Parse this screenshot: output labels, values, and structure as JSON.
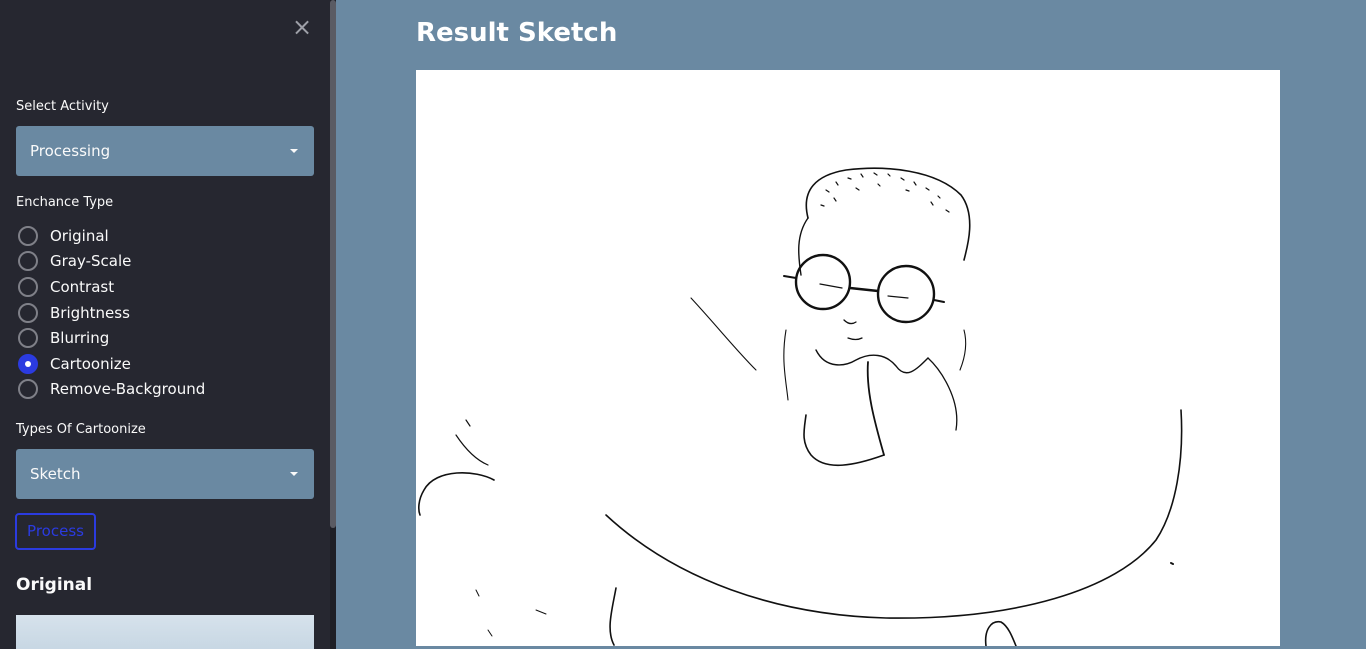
{
  "sidebar": {
    "close_label": "×",
    "select_activity": {
      "label": "Select Activity",
      "value": "Processing"
    },
    "enhance_type": {
      "label": "Enchance Type",
      "options": [
        {
          "label": "Original",
          "checked": false
        },
        {
          "label": "Gray-Scale",
          "checked": false
        },
        {
          "label": "Contrast",
          "checked": false
        },
        {
          "label": "Brightness",
          "checked": false
        },
        {
          "label": "Blurring",
          "checked": false
        },
        {
          "label": "Cartoonize",
          "checked": true
        },
        {
          "label": "Remove-Background",
          "checked": false
        }
      ]
    },
    "cartoonize_type": {
      "label": "Types Of Cartoonize",
      "value": "Sketch"
    },
    "process_label": "Process",
    "original_heading": "Original"
  },
  "main": {
    "title": "Result Sketch"
  },
  "colors": {
    "sidebar_bg": "#262730",
    "main_bg": "#6a89a2",
    "accent": "#2b3be0"
  },
  "icons": {
    "close": "close-icon",
    "caret": "chevron-down-icon"
  }
}
